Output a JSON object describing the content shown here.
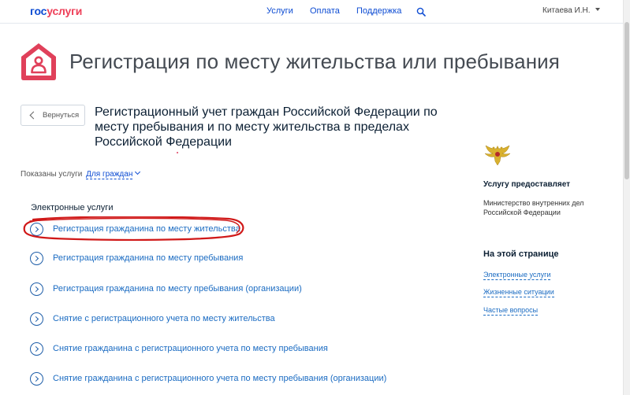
{
  "header": {
    "logo_part1": "гос",
    "logo_part2": "услуги",
    "nav": [
      "Услуги",
      "Оплата",
      "Поддержка"
    ],
    "user_name": "Китаева И.Н."
  },
  "page_title": "Регистрация по месту жительства или пребывания",
  "back_label": "Вернуться",
  "service_title": "Регистрационный учет граждан Российской Федерации по месту пребывания и по месту жительства в пределах Российской Федерации",
  "filter": {
    "label": "Показаны услуги",
    "value": "Для граждан"
  },
  "services_heading": "Электронные услуги",
  "services": [
    "Регистрация гражданина по месту жительства",
    "Регистрация гражданина по месту пребывания",
    "Регистрация гражданина по месту пребывания (организации)",
    "Снятие с регистрационного учета по месту жительства",
    "Снятие гражданина с регистрационного учета по месту пребывания",
    "Снятие гражданина с регистрационного учета по месту пребывания (организации)"
  ],
  "sidebar": {
    "provider_heading": "Услугу предоставляет",
    "provider_name": "Министерство внутренних дел Российской Федерации",
    "onpage_heading": "На этой странице",
    "links": [
      "Электронные услуги",
      "Жизненные ситуации",
      "Частые вопросы"
    ]
  },
  "colors": {
    "brand_blue": "#0d4cd3",
    "brand_red": "#ee3f58",
    "link_blue": "#1a6bc2",
    "icon_red": "#e0405a",
    "annotation_red": "#d01818"
  },
  "icons": [
    "search-icon",
    "house-person-icon",
    "chevron-left-icon",
    "chevron-down-icon",
    "chevron-right-circle-icon",
    "double-headed-eagle-emblem-icon"
  ]
}
